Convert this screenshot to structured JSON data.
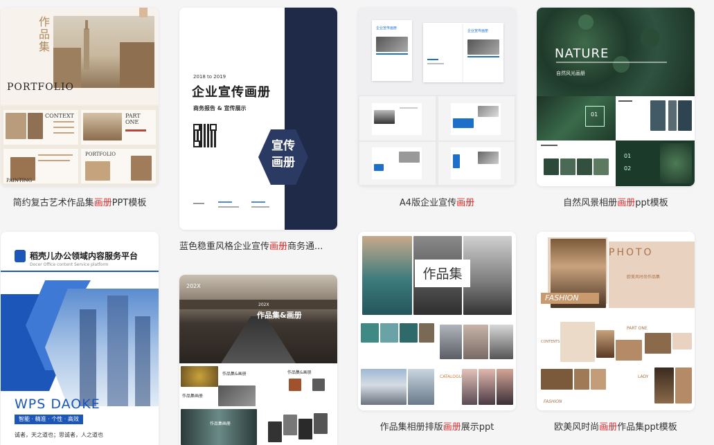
{
  "templates": [
    {
      "pre": "简约复古艺术作品集",
      "hl": "画册",
      "post": "PPT模板",
      "t1": "作品集",
      "t2": "PORTFOLIO",
      "t3": "CONTEXT",
      "t4": "PART ONE",
      "t5": "PAINTING",
      "t6": "PORTFOLIO"
    },
    {
      "pre": "蓝色稳重风格企业宣传",
      "hl": "画册",
      "post": "商务通...",
      "t1": "2018 to 2019",
      "t2": "企业宣传画册",
      "t3": "商务报告 & 宣传展示",
      "t4": "宣传",
      "t5": "画册"
    },
    {
      "pre": "A4版企业宣传",
      "hl": "画册",
      "post": "",
      "t1": "企业宣传画册"
    },
    {
      "pre": "自然风景相册",
      "hl": "画册",
      "post": "ppt模板",
      "t1": "NATURE",
      "t2": "自然风光画册",
      "t3": "01",
      "t4": "02"
    },
    {
      "pre": "",
      "hl": "",
      "post": "",
      "t1": "稻壳儿办公领域内容服务平台",
      "t2": "Docer Office content Service platform",
      "t3": "WPS  DAOKE",
      "t4": "智能 · 精准 · 个性 · 高效",
      "t5": "诚者，天之道也；思诚者，人之道也"
    },
    {
      "pre": "",
      "hl": "",
      "post": "",
      "t1": "202X",
      "t2": "作品集&画册",
      "t3": "作品集&画册",
      "t4": "作品集&画册",
      "t5": "作品集画册",
      "t6": "作品集画册"
    },
    {
      "pre": "作品集相册排版",
      "hl": "画册",
      "post": "展示ppt",
      "t1": "作品集",
      "t2": "CATALOGUE"
    },
    {
      "pre": "欧美风时尚",
      "hl": "画册",
      "post": "作品集ppt模板",
      "t1": "PHOTO",
      "t2": "FASHION",
      "t3": "PART ONE",
      "t4": "CONTENTS",
      "t5": "LADY",
      "t6": "FASHION",
      "t7": "欧美风时尚作品集"
    }
  ]
}
